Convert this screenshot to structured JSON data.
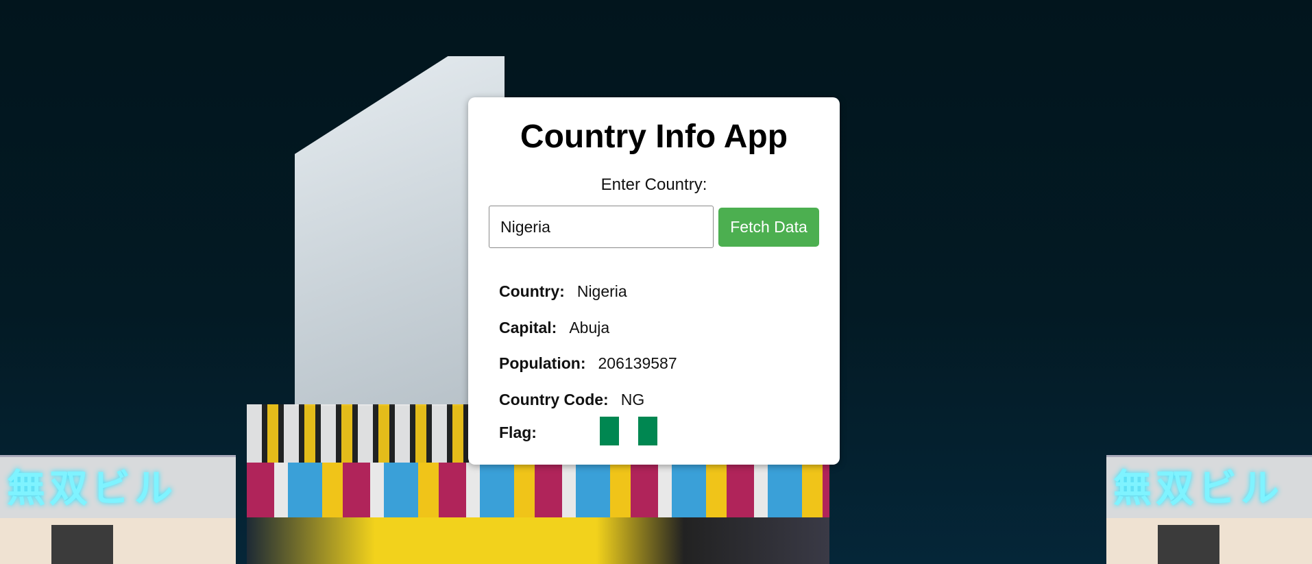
{
  "app": {
    "title": "Country Info App"
  },
  "form": {
    "label": "Enter Country:",
    "input_value": "Nigeria",
    "button_label": "Fetch Data"
  },
  "results": {
    "country": {
      "label": "Country:",
      "value": "Nigeria"
    },
    "capital": {
      "label": "Capital:",
      "value": "Abuja"
    },
    "population": {
      "label": "Population:",
      "value": "206139587"
    },
    "country_code": {
      "label": "Country Code:",
      "value": "NG"
    },
    "flag": {
      "label": "Flag:",
      "colors": [
        "#008751",
        "#ffffff",
        "#008751"
      ]
    }
  },
  "background": {
    "neon_text": "無双ビル"
  },
  "colors": {
    "button": "#4caf50",
    "card": "#ffffff",
    "flag_green": "#008751"
  }
}
